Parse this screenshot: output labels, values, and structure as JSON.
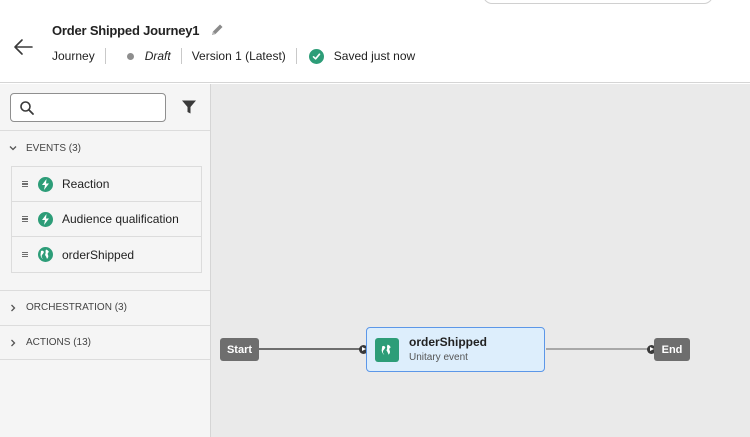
{
  "header": {
    "title": "Order Shipped Journey1",
    "type_label": "Journey",
    "status": "Draft",
    "version": "Version 1 (Latest)",
    "save_status": "Saved just now"
  },
  "sidebar": {
    "search": {
      "placeholder": "",
      "value": ""
    },
    "sections": {
      "events": {
        "label": "EVENTS (3)",
        "expanded": true,
        "items": [
          {
            "label": "Reaction",
            "icon": "lightning-icon"
          },
          {
            "label": "Audience qualification",
            "icon": "lightning-icon"
          },
          {
            "label": "orderShipped",
            "icon": "globe-icon"
          }
        ]
      },
      "orchestration": {
        "label": "ORCHESTRATION (3)",
        "expanded": false
      },
      "actions": {
        "label": "ACTIONS (13)",
        "expanded": false
      }
    }
  },
  "canvas": {
    "start_label": "Start",
    "end_label": "End",
    "node": {
      "title": "orderShipped",
      "subtitle": "Unitary event",
      "icon": "globe-icon"
    }
  },
  "colors": {
    "accent_green": "#2d9d78",
    "node_border": "#5c97e8",
    "node_fill": "#ddeefc",
    "canvas_bg": "#eaeaea"
  }
}
